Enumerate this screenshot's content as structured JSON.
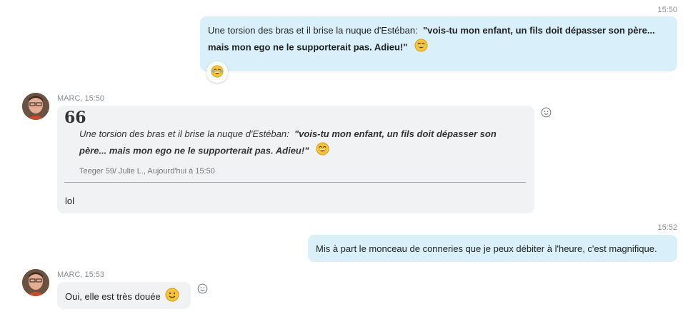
{
  "messages": {
    "m1": {
      "time": "15:50",
      "text_plain": "Une torsion des bras et il brise la nuque d'Estéban:",
      "text_bold_line1": "\"vois-tu mon enfant, un fils doit dépasser son père...",
      "text_bold_line2": "mais mon ego ne le supporterait pas. Adieu!\"",
      "emoji": "laughing-emoji",
      "reaction": "laughing-emoji"
    },
    "m2": {
      "sender": "MARC, 15:50",
      "quote_mark": "66",
      "quote_plain": "Une torsion des bras et il brise la nuque d'Estéban:",
      "quote_bold_line1": "\"vois-tu mon enfant, un fils doit dépasser son",
      "quote_bold_line2": "père... mais mon ego ne le supporterait pas. Adieu!\"",
      "quote_meta": "Teeger 59/ Julie L., Aujourd'hui à 15:50",
      "reply": "lol"
    },
    "m3": {
      "time": "15:52",
      "text": "Mis à part le monceau de conneries que je peux débiter à l'heure, c'est magnifique."
    },
    "m4": {
      "sender": "MARC, 15:53",
      "text": "Oui, elle est très douée",
      "emoji": "smile-emoji"
    }
  },
  "colors": {
    "outgoing_bubble": "#d9f0fb",
    "incoming_bubble": "#f1f2f4",
    "emoji_yellow": "#f7c531"
  }
}
